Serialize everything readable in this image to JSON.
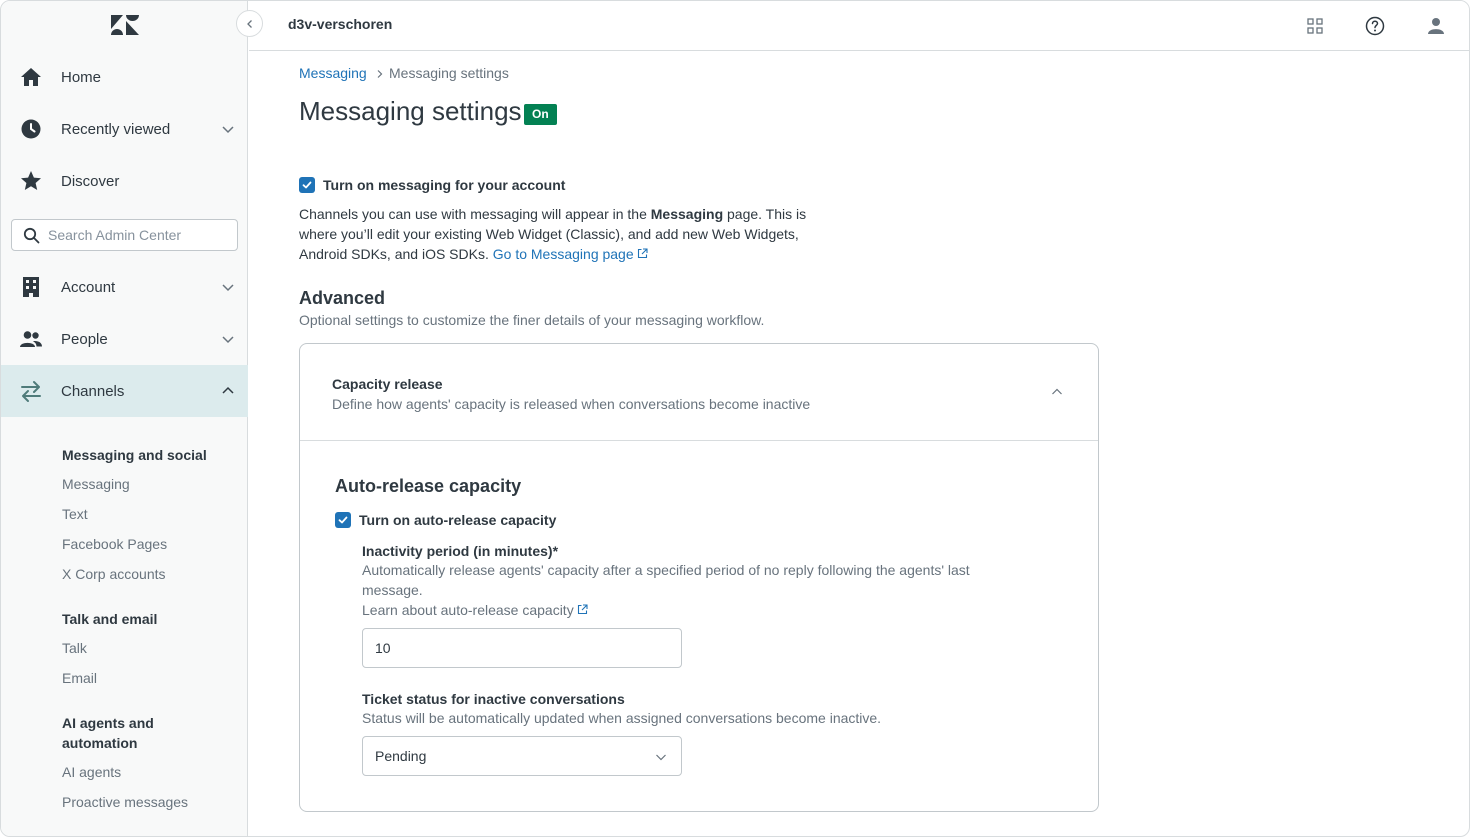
{
  "header": {
    "title": "d3v-verschoren",
    "icons": [
      "apps-grid-icon",
      "help-icon",
      "user-profile-icon"
    ]
  },
  "sidebar": {
    "logo": "zendesk-logo",
    "nav": {
      "home": "Home",
      "recently_viewed": "Recently viewed",
      "discover": "Discover",
      "account": "Account",
      "people": "People",
      "channels": "Channels"
    },
    "search_placeholder": "Search Admin Center",
    "groups": {
      "messaging_social": "Messaging and social",
      "talk_email": "Talk and email",
      "ai_automation": "AI agents and automation"
    },
    "links": {
      "messaging": "Messaging",
      "text": "Text",
      "facebook": "Facebook Pages",
      "xcorp": "X Corp accounts",
      "talk": "Talk",
      "email": "Email",
      "ai_agents": "AI agents",
      "proactive": "Proactive messages"
    },
    "active_color": "#dcebed"
  },
  "main": {
    "breadcrumb": {
      "parent": "Messaging",
      "current": "Messaging settings"
    },
    "title": "Messaging settings",
    "badge": "On",
    "badge_color": "#038153",
    "turn_on": {
      "label": "Turn on messaging for your account",
      "checked": true
    },
    "description": {
      "part1": "Channels you can use with messaging will appear in the ",
      "bold": "Messaging",
      "part2": " page. This is where you’ll edit your existing Web Widget (Classic), and add new Web Widgets, Android SDKs, and iOS SDKs. ",
      "link": "Go to Messaging page"
    },
    "advanced": {
      "heading": "Advanced",
      "subtitle": "Optional settings to customize the finer details of your messaging workflow."
    },
    "capacity": {
      "title": "Capacity release",
      "description": "Define how agents' capacity is released when conversations become inactive",
      "expanded": true,
      "section_heading": "Auto-release capacity",
      "auto_release": {
        "label": "Turn on auto-release capacity",
        "checked": true
      },
      "inactivity": {
        "label": "Inactivity period (in minutes)*",
        "hint": "Automatically release agents' capacity after a specified period of no reply following the agents' last message.",
        "link": "Learn about auto-release capacity",
        "value": "10"
      },
      "ticket_status": {
        "label": "Ticket status for inactive conversations",
        "hint": "Status will be automatically updated when assigned conversations become inactive.",
        "selected": "Pending"
      }
    },
    "accent_color": "#1f73b7"
  }
}
